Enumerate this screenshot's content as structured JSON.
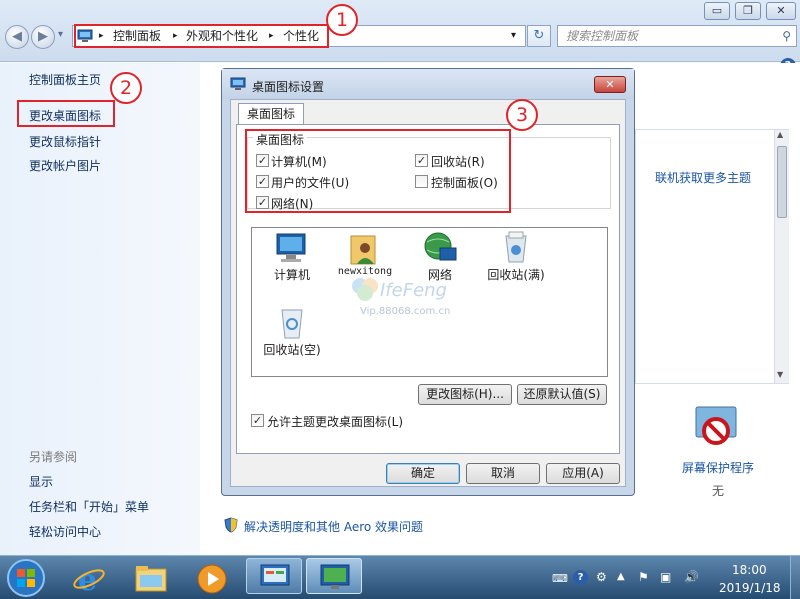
{
  "window": {
    "minimize": "▭",
    "maximize": "❐",
    "close": "✕"
  },
  "nav": {
    "back": "◀",
    "forward": "▶",
    "dropdown": "▾"
  },
  "address": {
    "segments": [
      "控制面板",
      "外观和个性化",
      "个性化"
    ],
    "sep": "▸",
    "dropdown": "▾",
    "refresh": "↻"
  },
  "search": {
    "placeholder": "搜索控制面板",
    "icon": "🔍"
  },
  "help": "?",
  "annotations": [
    "1",
    "2",
    "3"
  ],
  "sidebar": {
    "items": [
      "控制面板主页",
      "更改桌面图标",
      "更改鼠标指针",
      "更改帐户图片"
    ],
    "see_also_title": "另请参阅",
    "see_also": [
      "显示",
      "任务栏和「开始」菜单",
      "轻松访问中心"
    ]
  },
  "main": {
    "more_themes_link": "联机获取更多主题",
    "screensaver_label": "屏幕保护程序",
    "screensaver_value": "无",
    "troubleshoot_link": "解决透明度和其他 Aero 效果问题"
  },
  "dialog": {
    "title": "桌面图标设置",
    "tab": "桌面图标",
    "group_title": "桌面图标",
    "checkboxes": [
      {
        "label": "计算机(M)",
        "checked": true
      },
      {
        "label": "回收站(R)",
        "checked": true
      },
      {
        "label": "用户的文件(U)",
        "checked": true
      },
      {
        "label": "控制面板(O)",
        "checked": false
      },
      {
        "label": "网络(N)",
        "checked": true
      }
    ],
    "check_mark": "✓",
    "icons": [
      "计算机",
      "newxitong",
      "网络",
      "回收站(满)",
      "回收站(空)"
    ],
    "watermark_brand": "IfeFeng",
    "watermark_url": "Vip.88068.com.cn",
    "change_icon_btn": "更改图标(H)...",
    "restore_default_btn": "还原默认值(S)",
    "allow_themes": "允许主题更改桌面图标(L)",
    "ok": "确定",
    "cancel": "取消",
    "apply": "应用(A)"
  },
  "taskbar": {
    "time": "18:00",
    "date": "2019/1/18"
  }
}
